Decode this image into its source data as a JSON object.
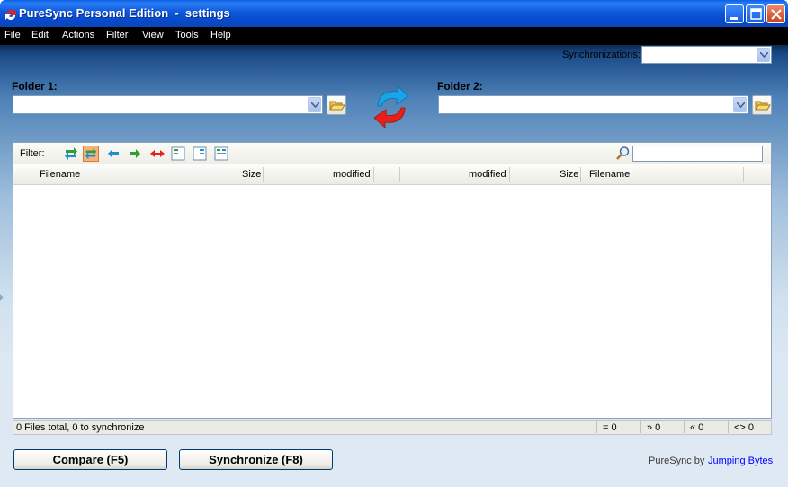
{
  "window": {
    "title": "PureSync Personal Edition  -  settings",
    "app_icon": "puresync-logo-icon",
    "buttons": [
      "minimize-icon",
      "maximize-icon",
      "close-icon"
    ]
  },
  "menu": {
    "items": [
      "File",
      "Edit",
      "Actions",
      "Filter",
      "View",
      "Tools",
      "Help"
    ]
  },
  "sync": {
    "label": "Synchronizations:",
    "value": ""
  },
  "folder1": {
    "label": "Folder 1:",
    "value": ""
  },
  "folder2": {
    "label": "Folder 2:",
    "value": ""
  },
  "filter": {
    "label": "Filter:",
    "icons": [
      "filter-all-icon",
      "filter-changed-icon",
      "filter-left-icon",
      "filter-right-icon",
      "filter-conflict-icon",
      "view-left-icon",
      "view-right-icon",
      "view-both-icon"
    ],
    "active_icon": "filter-changed-icon",
    "search_value": ""
  },
  "columns": {
    "left_filename": "Filename",
    "left_size": "Size",
    "left_modified": "modified",
    "right_modified": "modified",
    "right_size": "Size",
    "right_filename": "Filename"
  },
  "rows": [],
  "status": {
    "text": "0 Files total,  0 to synchronize",
    "equal": "= 0",
    "newer_right": "» 0",
    "newer_left": "« 0",
    "different": "<> 0"
  },
  "buttons": {
    "compare": "Compare (F5)",
    "synchronize": "Synchronize (F8)"
  },
  "footer": {
    "text": "PureSync by",
    "link": "Jumping Bytes"
  },
  "colors": {
    "titlebar": "#0a5fe8",
    "menubar": "#000000",
    "accent_blue": "#1aa3e8",
    "accent_red": "#e8201a",
    "active_filter": "#f5b27a"
  }
}
